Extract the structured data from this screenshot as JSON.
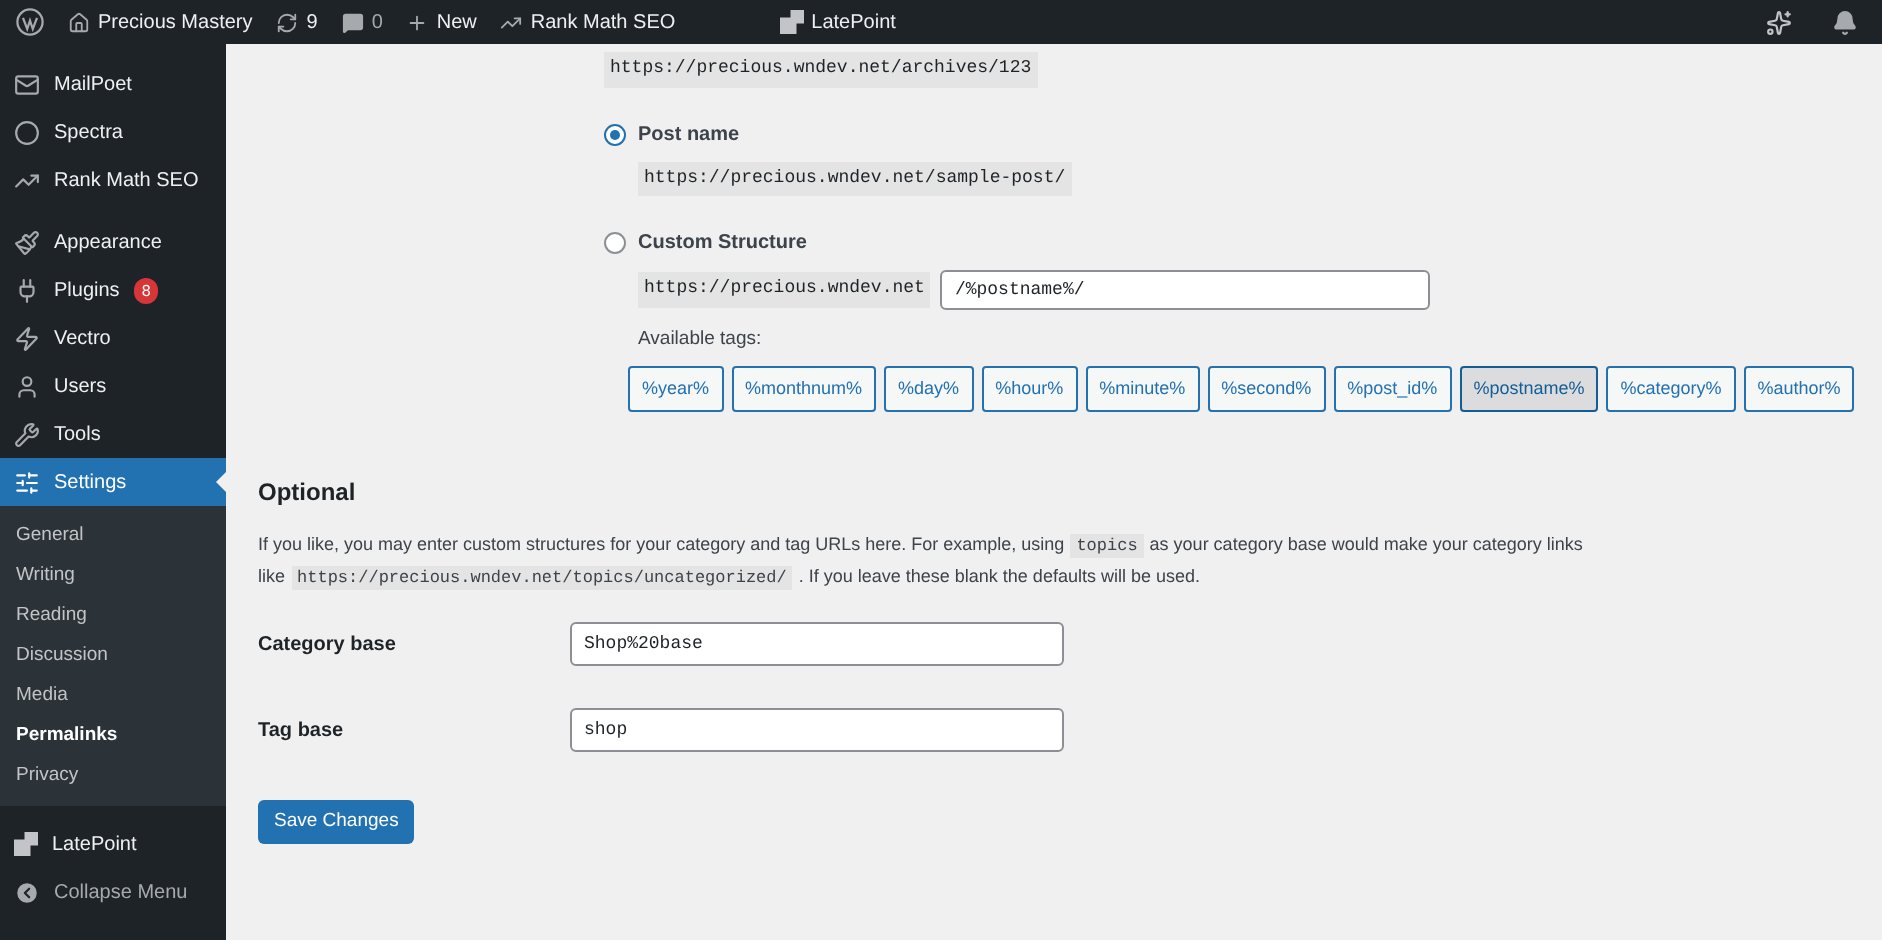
{
  "top_bar": {
    "site": "Precious Mastery",
    "updates": "9",
    "comments": "0",
    "new": "New",
    "items": [
      {
        "kind": "rankmath",
        "label": "Rank Math SEO"
      },
      {
        "kind": "latepoint",
        "label": "LatePoint"
      }
    ]
  },
  "sidebar": {
    "items": [
      {
        "kind": "mailpoet",
        "label": "MailPoet",
        "selected": false
      },
      {
        "kind": "spectra",
        "label": "Spectra",
        "selected": false
      },
      {
        "kind": "rankmath",
        "label": "Rank Math SEO",
        "selected": false
      },
      {
        "kind": "appearance",
        "label": "Appearance",
        "selected": false
      },
      {
        "kind": "plugins",
        "label": "Plugins",
        "selected": false,
        "badge": "8"
      },
      {
        "kind": "vectro",
        "label": "Vectro",
        "selected": false
      },
      {
        "kind": "users",
        "label": "Users",
        "selected": false
      },
      {
        "kind": "tools",
        "label": "Tools",
        "selected": false
      },
      {
        "kind": "settings",
        "label": "Settings",
        "selected": true,
        "children": [
          {
            "label": "General",
            "selected": false
          },
          {
            "label": "Writing",
            "selected": false
          },
          {
            "label": "Reading",
            "selected": false
          },
          {
            "label": "Discussion",
            "selected": false
          },
          {
            "label": "Media",
            "selected": false
          },
          {
            "label": "Permalinks",
            "selected": true
          },
          {
            "label": "Privacy",
            "selected": false
          }
        ]
      },
      {
        "kind": "latepoint",
        "label": "LatePoint",
        "selected": false
      }
    ],
    "collapse": "Collapse Menu"
  },
  "permalinks": {
    "previous_example": "https://precious.wndev.net/archives/123",
    "options": [
      {
        "label": "Post name",
        "selected": true,
        "example": "https://precious.wndev.net/sample-post/"
      },
      {
        "label": "Custom Structure",
        "selected": false,
        "prefix": "https://precious.wndev.net",
        "value": "/%postname%/"
      }
    ],
    "tags_label": "Available tags:",
    "tags": [
      {
        "label": "%year%",
        "selected": false
      },
      {
        "label": "%monthnum%",
        "selected": false
      },
      {
        "label": "%day%",
        "selected": false
      },
      {
        "label": "%hour%",
        "selected": false
      },
      {
        "label": "%minute%",
        "selected": false
      },
      {
        "label": "%second%",
        "selected": false
      },
      {
        "label": "%post_id%",
        "selected": false
      },
      {
        "label": "%postname%",
        "selected": true
      },
      {
        "label": "%category%",
        "selected": false
      },
      {
        "label": "%author%",
        "selected": false
      }
    ]
  },
  "optional": {
    "heading": "Optional",
    "description": [
      {
        "kind": "text",
        "text": "If you like, you may enter custom structures for your category and tag URLs here. For example, using"
      },
      {
        "kind": "code",
        "text": "topics"
      },
      {
        "kind": "text",
        "text": "as your category base would make your category links like"
      },
      {
        "kind": "code",
        "text": "https://precious.wndev.net/topics/uncategorized/"
      },
      {
        "kind": "text",
        "text": ". If you leave these blank the defaults will be used."
      }
    ],
    "fields": [
      {
        "label": "Category base",
        "value": "Shop%20base"
      },
      {
        "label": "Tag base",
        "value": "shop"
      }
    ]
  },
  "save_button": "Save Changes"
}
